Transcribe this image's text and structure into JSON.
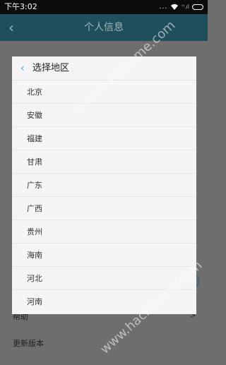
{
  "status_bar": {
    "time": "下午3:02",
    "dots": "...",
    "signal": "ᴴ.ıl"
  },
  "app_bar": {
    "back_icon": "chevron-left-icon",
    "title": "个人信息"
  },
  "dialog": {
    "back_icon": "chevron-left-icon",
    "title": "选择地区",
    "regions": [
      "北京",
      "安徽",
      "福建",
      "甘肃",
      "广东",
      "广西",
      "贵州",
      "海南",
      "河北",
      "河南"
    ]
  },
  "background_items": {
    "help_label": "帮助",
    "help_chevron": ">",
    "update_label": "更新版本"
  },
  "watermark": "www.hackhome.com",
  "colors": {
    "app_bar": "#1e4f5a",
    "overlay": "#6e6e6e",
    "dialog_bg": "#f6f4f6",
    "accent": "#3f9fd1"
  }
}
